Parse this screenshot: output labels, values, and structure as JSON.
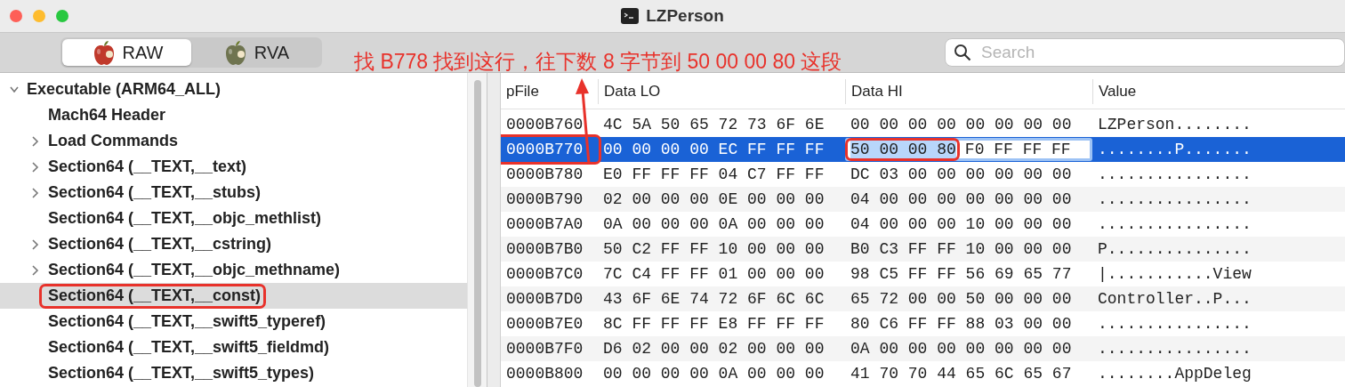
{
  "window": {
    "title": "LZPerson"
  },
  "modes": [
    {
      "label": "RAW",
      "selected": true
    },
    {
      "label": "RVA",
      "selected": false
    }
  ],
  "search": {
    "placeholder": "Search"
  },
  "annotation": {
    "text": "找 B778 找到这行，往下数 8 字节到 50 00 00 80 这段"
  },
  "tree": [
    {
      "label": "Executable  (ARM64_ALL)",
      "kind": "group",
      "expanded": true,
      "selected": false,
      "circled": false,
      "children": [
        {
          "label": "Mach64 Header",
          "kind": "leaf",
          "selected": false,
          "circled": false
        },
        {
          "label": "Load Commands",
          "kind": "group",
          "expanded": false,
          "selected": false,
          "circled": false
        },
        {
          "label": "Section64 (__TEXT,__text)",
          "kind": "group",
          "expanded": false,
          "selected": false,
          "circled": false
        },
        {
          "label": "Section64 (__TEXT,__stubs)",
          "kind": "group",
          "expanded": false,
          "selected": false,
          "circled": false
        },
        {
          "label": "Section64 (__TEXT,__objc_methlist)",
          "kind": "leaf",
          "selected": false,
          "circled": false
        },
        {
          "label": "Section64 (__TEXT,__cstring)",
          "kind": "group",
          "expanded": false,
          "selected": false,
          "circled": false
        },
        {
          "label": "Section64 (__TEXT,__objc_methname)",
          "kind": "group",
          "expanded": false,
          "selected": false,
          "circled": false
        },
        {
          "label": "Section64 (__TEXT,__const)",
          "kind": "leaf",
          "selected": true,
          "circled": true
        },
        {
          "label": "Section64 (__TEXT,__swift5_typeref)",
          "kind": "leaf",
          "selected": false,
          "circled": false
        },
        {
          "label": "Section64 (__TEXT,__swift5_fieldmd)",
          "kind": "leaf",
          "selected": false,
          "circled": false
        },
        {
          "label": "Section64 (__TEXT,__swift5_types)",
          "kind": "leaf",
          "selected": false,
          "circled": false
        }
      ]
    }
  ],
  "table": {
    "columns": [
      "pFile",
      "Data LO",
      "Data HI",
      "Value"
    ],
    "rows": [
      {
        "pfile": "0000B760",
        "data_lo": "4C 5A 50 65 72 73 6F 6E",
        "data_hi": "00 00 00 00 00 00 00 00",
        "value": "LZPerson........",
        "selected": false,
        "circled": false
      },
      {
        "pfile": "0000B770",
        "data_lo": "00 00 00 00 EC FF FF FF",
        "data_hi": {
          "marked": "50 00 00 80",
          "rest": "F0 FF FF FF",
          "circled": true
        },
        "value": "........P.......",
        "selected": true,
        "circled": true
      },
      {
        "pfile": "0000B780",
        "data_lo": "E0 FF FF FF 04 C7 FF FF",
        "data_hi": "DC 03 00 00 00 00 00 00",
        "value": "................",
        "selected": false,
        "circled": false
      },
      {
        "pfile": "0000B790",
        "data_lo": "02 00 00 00 0E 00 00 00",
        "data_hi": "04 00 00 00 00 00 00 00",
        "value": "................",
        "selected": false,
        "circled": false
      },
      {
        "pfile": "0000B7A0",
        "data_lo": "0A 00 00 00 0A 00 00 00",
        "data_hi": "04 00 00 00 10 00 00 00",
        "value": "................",
        "selected": false,
        "circled": false
      },
      {
        "pfile": "0000B7B0",
        "data_lo": "50 C2 FF FF 10 00 00 00",
        "data_hi": "B0 C3 FF FF 10 00 00 00",
        "value": "P...............",
        "selected": false,
        "circled": false
      },
      {
        "pfile": "0000B7C0",
        "data_lo": "7C C4 FF FF 01 00 00 00",
        "data_hi": "98 C5 FF FF 56 69 65 77",
        "value": "|...........View",
        "selected": false,
        "circled": false
      },
      {
        "pfile": "0000B7D0",
        "data_lo": "43 6F 6E 74 72 6F 6C 6C",
        "data_hi": "65 72 00 00 50 00 00 00",
        "value": "Controller..P...",
        "selected": false,
        "circled": false
      },
      {
        "pfile": "0000B7E0",
        "data_lo": "8C FF FF FF E8 FF FF FF",
        "data_hi": "80 C6 FF FF 88 03 00 00",
        "value": "................",
        "selected": false,
        "circled": false
      },
      {
        "pfile": "0000B7F0",
        "data_lo": "D6 02 00 00 02 00 00 00",
        "data_hi": "0A 00 00 00 00 00 00 00",
        "value": "................",
        "selected": false,
        "circled": false
      },
      {
        "pfile": "0000B800",
        "data_lo": "00 00 00 00 0A 00 00 00",
        "data_hi": "41 70 70 44 65 6C 65 67",
        "value": "........AppDeleg",
        "selected": false,
        "circled": false
      }
    ]
  }
}
